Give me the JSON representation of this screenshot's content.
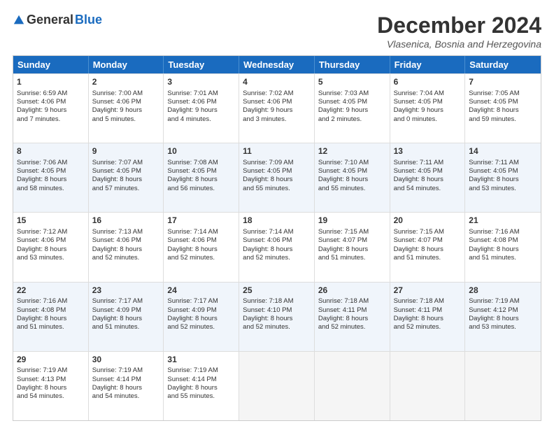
{
  "logo": {
    "general": "General",
    "blue": "Blue"
  },
  "title": "December 2024",
  "location": "Vlasenica, Bosnia and Herzegovina",
  "header_days": [
    "Sunday",
    "Monday",
    "Tuesday",
    "Wednesday",
    "Thursday",
    "Friday",
    "Saturday"
  ],
  "weeks": [
    [
      {
        "day": "1",
        "lines": [
          "Sunrise: 6:59 AM",
          "Sunset: 4:06 PM",
          "Daylight: 9 hours",
          "and 7 minutes."
        ]
      },
      {
        "day": "2",
        "lines": [
          "Sunrise: 7:00 AM",
          "Sunset: 4:06 PM",
          "Daylight: 9 hours",
          "and 5 minutes."
        ]
      },
      {
        "day": "3",
        "lines": [
          "Sunrise: 7:01 AM",
          "Sunset: 4:06 PM",
          "Daylight: 9 hours",
          "and 4 minutes."
        ]
      },
      {
        "day": "4",
        "lines": [
          "Sunrise: 7:02 AM",
          "Sunset: 4:06 PM",
          "Daylight: 9 hours",
          "and 3 minutes."
        ]
      },
      {
        "day": "5",
        "lines": [
          "Sunrise: 7:03 AM",
          "Sunset: 4:05 PM",
          "Daylight: 9 hours",
          "and 2 minutes."
        ]
      },
      {
        "day": "6",
        "lines": [
          "Sunrise: 7:04 AM",
          "Sunset: 4:05 PM",
          "Daylight: 9 hours",
          "and 0 minutes."
        ]
      },
      {
        "day": "7",
        "lines": [
          "Sunrise: 7:05 AM",
          "Sunset: 4:05 PM",
          "Daylight: 8 hours",
          "and 59 minutes."
        ]
      }
    ],
    [
      {
        "day": "8",
        "lines": [
          "Sunrise: 7:06 AM",
          "Sunset: 4:05 PM",
          "Daylight: 8 hours",
          "and 58 minutes."
        ]
      },
      {
        "day": "9",
        "lines": [
          "Sunrise: 7:07 AM",
          "Sunset: 4:05 PM",
          "Daylight: 8 hours",
          "and 57 minutes."
        ]
      },
      {
        "day": "10",
        "lines": [
          "Sunrise: 7:08 AM",
          "Sunset: 4:05 PM",
          "Daylight: 8 hours",
          "and 56 minutes."
        ]
      },
      {
        "day": "11",
        "lines": [
          "Sunrise: 7:09 AM",
          "Sunset: 4:05 PM",
          "Daylight: 8 hours",
          "and 55 minutes."
        ]
      },
      {
        "day": "12",
        "lines": [
          "Sunrise: 7:10 AM",
          "Sunset: 4:05 PM",
          "Daylight: 8 hours",
          "and 55 minutes."
        ]
      },
      {
        "day": "13",
        "lines": [
          "Sunrise: 7:11 AM",
          "Sunset: 4:05 PM",
          "Daylight: 8 hours",
          "and 54 minutes."
        ]
      },
      {
        "day": "14",
        "lines": [
          "Sunrise: 7:11 AM",
          "Sunset: 4:05 PM",
          "Daylight: 8 hours",
          "and 53 minutes."
        ]
      }
    ],
    [
      {
        "day": "15",
        "lines": [
          "Sunrise: 7:12 AM",
          "Sunset: 4:06 PM",
          "Daylight: 8 hours",
          "and 53 minutes."
        ]
      },
      {
        "day": "16",
        "lines": [
          "Sunrise: 7:13 AM",
          "Sunset: 4:06 PM",
          "Daylight: 8 hours",
          "and 52 minutes."
        ]
      },
      {
        "day": "17",
        "lines": [
          "Sunrise: 7:14 AM",
          "Sunset: 4:06 PM",
          "Daylight: 8 hours",
          "and 52 minutes."
        ]
      },
      {
        "day": "18",
        "lines": [
          "Sunrise: 7:14 AM",
          "Sunset: 4:06 PM",
          "Daylight: 8 hours",
          "and 52 minutes."
        ]
      },
      {
        "day": "19",
        "lines": [
          "Sunrise: 7:15 AM",
          "Sunset: 4:07 PM",
          "Daylight: 8 hours",
          "and 51 minutes."
        ]
      },
      {
        "day": "20",
        "lines": [
          "Sunrise: 7:15 AM",
          "Sunset: 4:07 PM",
          "Daylight: 8 hours",
          "and 51 minutes."
        ]
      },
      {
        "day": "21",
        "lines": [
          "Sunrise: 7:16 AM",
          "Sunset: 4:08 PM",
          "Daylight: 8 hours",
          "and 51 minutes."
        ]
      }
    ],
    [
      {
        "day": "22",
        "lines": [
          "Sunrise: 7:16 AM",
          "Sunset: 4:08 PM",
          "Daylight: 8 hours",
          "and 51 minutes."
        ]
      },
      {
        "day": "23",
        "lines": [
          "Sunrise: 7:17 AM",
          "Sunset: 4:09 PM",
          "Daylight: 8 hours",
          "and 51 minutes."
        ]
      },
      {
        "day": "24",
        "lines": [
          "Sunrise: 7:17 AM",
          "Sunset: 4:09 PM",
          "Daylight: 8 hours",
          "and 52 minutes."
        ]
      },
      {
        "day": "25",
        "lines": [
          "Sunrise: 7:18 AM",
          "Sunset: 4:10 PM",
          "Daylight: 8 hours",
          "and 52 minutes."
        ]
      },
      {
        "day": "26",
        "lines": [
          "Sunrise: 7:18 AM",
          "Sunset: 4:11 PM",
          "Daylight: 8 hours",
          "and 52 minutes."
        ]
      },
      {
        "day": "27",
        "lines": [
          "Sunrise: 7:18 AM",
          "Sunset: 4:11 PM",
          "Daylight: 8 hours",
          "and 52 minutes."
        ]
      },
      {
        "day": "28",
        "lines": [
          "Sunrise: 7:19 AM",
          "Sunset: 4:12 PM",
          "Daylight: 8 hours",
          "and 53 minutes."
        ]
      }
    ],
    [
      {
        "day": "29",
        "lines": [
          "Sunrise: 7:19 AM",
          "Sunset: 4:13 PM",
          "Daylight: 8 hours",
          "and 54 minutes."
        ]
      },
      {
        "day": "30",
        "lines": [
          "Sunrise: 7:19 AM",
          "Sunset: 4:14 PM",
          "Daylight: 8 hours",
          "and 54 minutes."
        ]
      },
      {
        "day": "31",
        "lines": [
          "Sunrise: 7:19 AM",
          "Sunset: 4:14 PM",
          "Daylight: 8 hours",
          "and 55 minutes."
        ]
      },
      null,
      null,
      null,
      null
    ]
  ],
  "row_alts": [
    false,
    true,
    false,
    true,
    false
  ]
}
